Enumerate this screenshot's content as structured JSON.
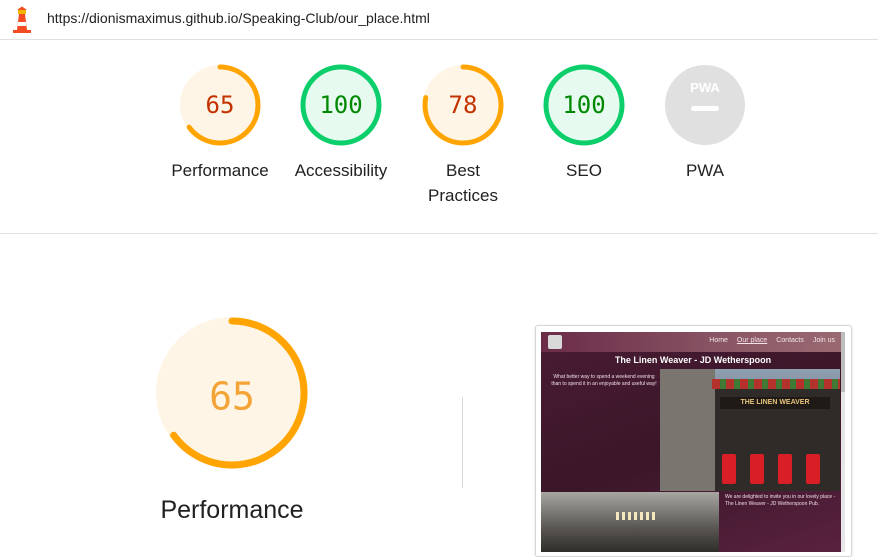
{
  "url": "https://dionismaximus.github.io/Speaking-Club/our_place.html",
  "colors": {
    "average": "#ffa400",
    "average_text": "#c33300",
    "average_bg": "#fff5e6",
    "pass": "#0cce6b",
    "pass_text": "#008800",
    "pass_bg": "#e6faf0",
    "na": "#e0e0e0"
  },
  "scores": [
    {
      "label": "Performance",
      "value": "65",
      "score": 65,
      "rating": "average"
    },
    {
      "label": "Accessibility",
      "value": "100",
      "score": 100,
      "rating": "pass"
    },
    {
      "label": "Best Practices",
      "value": "78",
      "score": 78,
      "rating": "average"
    },
    {
      "label": "SEO",
      "value": "100",
      "score": 100,
      "rating": "pass"
    },
    {
      "label": "PWA",
      "value": "",
      "score": null,
      "rating": "na",
      "badge": "PWA"
    }
  ],
  "performance": {
    "value": "65",
    "score": 65,
    "label": "Performance"
  },
  "screenshot": {
    "nav_items": [
      "Home",
      "Our place",
      "Contacts",
      "Join us"
    ],
    "title": "The Linen Weaver - JD Wetherspoon",
    "text1": "What better way to spend a weekend evening than to spend it in an enjoyable and useful way!",
    "pub_sign": "THE LINEN WEAVER",
    "text2": "We are delighted to invite you in our lovely place - The Linen Weaver - JD Wetherspoon Pub."
  }
}
